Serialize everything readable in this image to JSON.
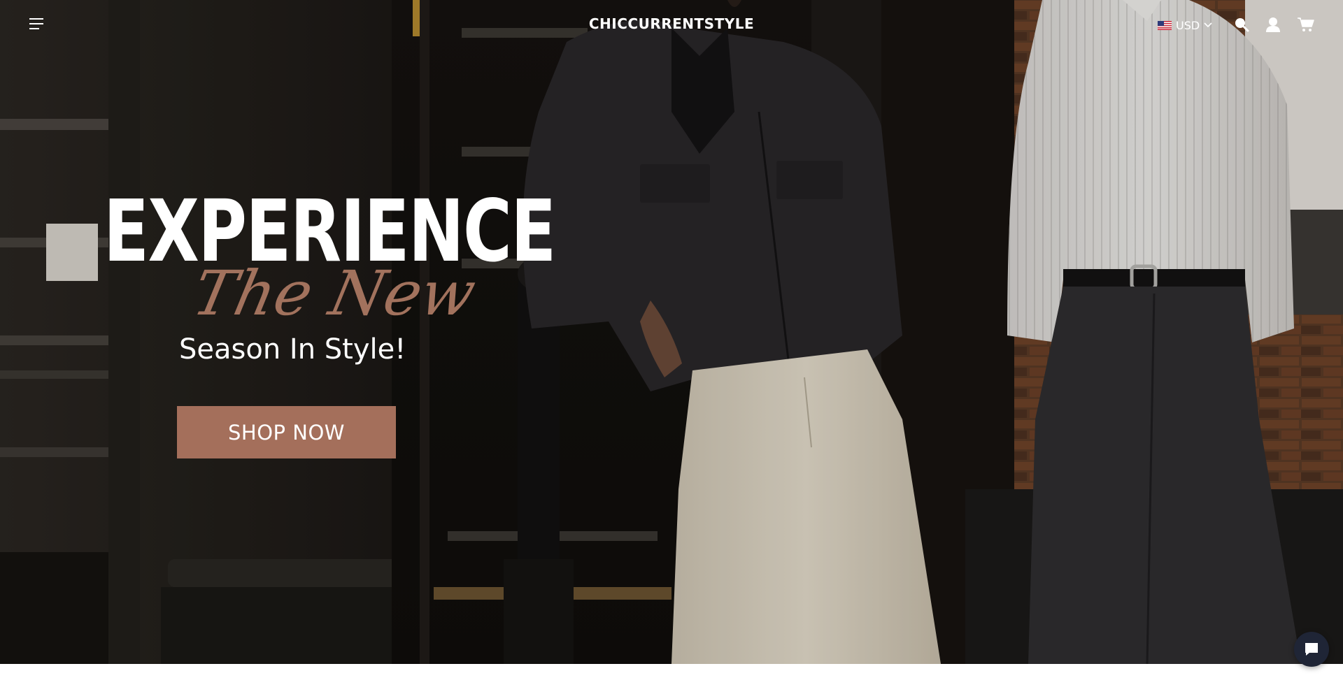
{
  "header": {
    "menu_icon": "hamburger-menu-icon",
    "brand": "CHICCURRENTSTYLE",
    "currency": {
      "label": "USD",
      "flag_icon": "us-flag-icon",
      "dropdown_icon": "chevron-down-icon"
    },
    "icons": [
      "search-icon",
      "account-icon",
      "cart-icon"
    ]
  },
  "hero": {
    "headline": "EXPERIENCE",
    "script_line": "The New",
    "subline": "Season In Style!",
    "cta_label": "SHOP NOW"
  },
  "chat_widget": {
    "icon": "chat-bubble-icon"
  },
  "colors": {
    "accent": "#a46f5b",
    "text_light": "#ffffff",
    "chat_bg": "#1f2536"
  }
}
